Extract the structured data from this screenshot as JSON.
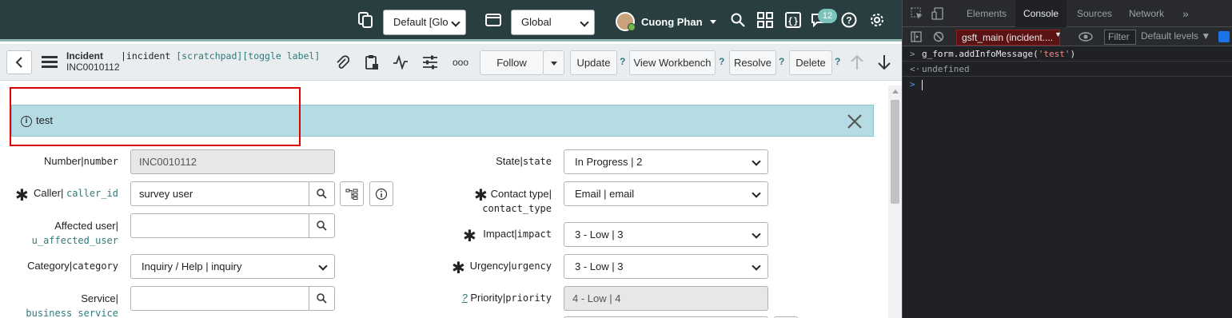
{
  "topbar": {
    "domain_select": "Default [Glo",
    "app_scope_select": "Global",
    "user_name": "Cuong Phan",
    "notification_count": "12"
  },
  "form_header": {
    "record_type": "Incident",
    "record_number": "INC0010112",
    "table_tech": "|incident",
    "scratchpad_link": "[scratchpad]",
    "toggle_label_link": "[toggle label]",
    "more_label": "ooo",
    "buttons": {
      "follow": "Follow",
      "update": "Update",
      "view_workbench": "View Workbench",
      "resolve": "Resolve",
      "delete": "Delete"
    },
    "help_mark": "?"
  },
  "info_message": {
    "icon": "i",
    "text": "test"
  },
  "fields": {
    "number": {
      "label": "Number",
      "sep": "|",
      "tech": "number",
      "value": "INC0010112"
    },
    "caller": {
      "label": "Caller",
      "sep": "|",
      "tech": "caller_id",
      "value": "survey user"
    },
    "affected_user": {
      "label": "Affected user",
      "sep": "|",
      "tech": "u_affected_user",
      "value": ""
    },
    "category": {
      "label": "Category",
      "sep": "|",
      "tech": "category",
      "value": "Inquiry / Help | inquiry"
    },
    "service": {
      "label": "Service",
      "sep": "|",
      "tech": "business_service",
      "value": ""
    },
    "state": {
      "label": "State",
      "sep": "|",
      "tech": "state",
      "value": "In Progress | 2"
    },
    "contact_type": {
      "label": "Contact type",
      "sep": "|",
      "tech": "contact_type",
      "value": "Email | email"
    },
    "impact": {
      "label": "Impact",
      "sep": "|",
      "tech": "impact",
      "value": "3 - Low | 3"
    },
    "urgency": {
      "label": "Urgency",
      "sep": "|",
      "tech": "urgency",
      "value": "3 - Low | 3"
    },
    "priority": {
      "label": "Priority",
      "sep": "|",
      "tech": "priority",
      "value": "4 - Low | 4",
      "hint": "?"
    }
  },
  "devtools": {
    "tabs": [
      "Elements",
      "Console",
      "Sources",
      "Network"
    ],
    "more_tabs": "»",
    "context": "gsft_main (incident....",
    "filter_placeholder": "Filter",
    "levels": "Default levels ▼",
    "console": {
      "input_prompt": ">",
      "command_prefix": "g_form.",
      "command_fn": "addInfoMessage(",
      "command_arg": "'test'",
      "command_suffix": ")",
      "result_prompt": "<·",
      "result": "undefined"
    }
  },
  "colors": {
    "topbar_bg": "#293e40",
    "info_bg": "#b5dbe3",
    "highlight_border": "#e00000",
    "console_bg": "#202124",
    "console_context_bg": "#5b1212"
  }
}
